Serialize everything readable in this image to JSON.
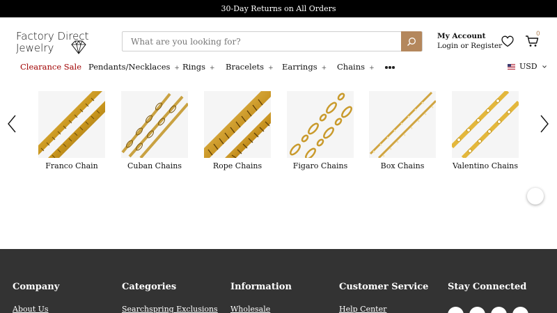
{
  "announcement": "30-Day Returns on All Orders",
  "logo": {
    "line1": "Factory Direct",
    "line2": "Jewelry",
    "icon": "diamond-icon"
  },
  "search": {
    "placeholder": "What are you looking for?",
    "value": "",
    "icon": "search-icon"
  },
  "account": {
    "title": "My Account",
    "subtitle": "Login or Register"
  },
  "wishlist": {
    "icon": "heart-icon"
  },
  "cart": {
    "icon": "cart-icon",
    "count": "0"
  },
  "nav": {
    "items": [
      {
        "label": "Clearance Sale",
        "has_submenu": false
      },
      {
        "label": "Pendants/Necklaces",
        "has_submenu": true
      },
      {
        "label": "Rings",
        "has_submenu": true
      },
      {
        "label": "Bracelets",
        "has_submenu": true
      },
      {
        "label": "Earrings",
        "has_submenu": true
      },
      {
        "label": "Chains",
        "has_submenu": true
      }
    ],
    "plus": "+",
    "more_icon": "more-dots-icon",
    "currency": "USD",
    "sale_color": "#a00000"
  },
  "carousel": {
    "items": [
      {
        "label": "Franco Chain"
      },
      {
        "label": "Cuban Chains"
      },
      {
        "label": "Rope Chains"
      },
      {
        "label": "Figaro Chains"
      },
      {
        "label": "Box Chains"
      },
      {
        "label": "Valentino Chains"
      }
    ],
    "prev_icon": "chevron-left-icon",
    "next_icon": "chevron-right-icon"
  },
  "footer": {
    "columns": [
      {
        "heading": "Company",
        "first_link": "About Us"
      },
      {
        "heading": "Categories",
        "first_link": "Searchspring Exclusions"
      },
      {
        "heading": "Information",
        "first_link": "Wholesale"
      },
      {
        "heading": "Customer Service",
        "first_link": "Help Center"
      },
      {
        "heading": "Stay Connected",
        "first_link": ""
      }
    ],
    "social_icons": [
      "facebook-icon",
      "twitter-icon",
      "pinterest-icon",
      "instagram-icon"
    ]
  },
  "colors": {
    "accent": "#b4875c",
    "footer_bg": "#333333",
    "topbar_bg": "#000000"
  }
}
